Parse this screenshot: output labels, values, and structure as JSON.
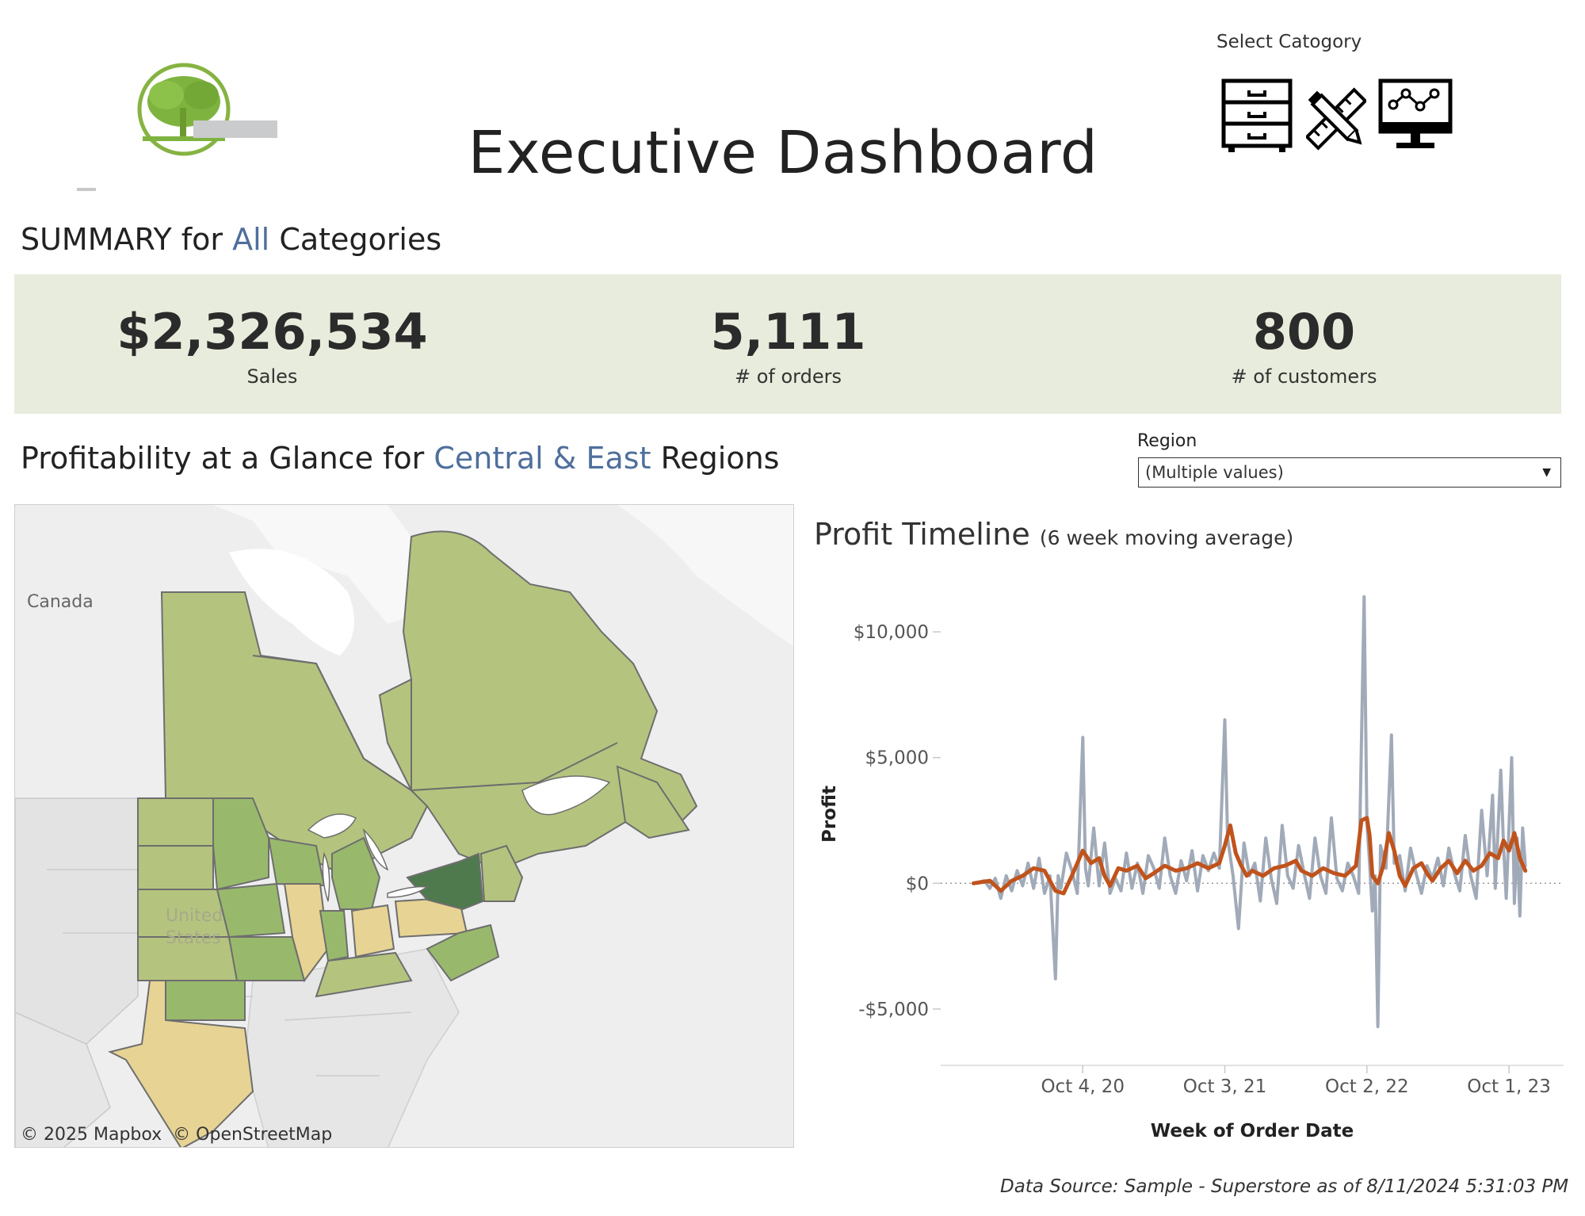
{
  "header": {
    "title": "Executive Dashboard",
    "category_selector_label": "Select Catogory",
    "category_icons": [
      "file-cabinet-icon",
      "pencil-ruler-icon",
      "computer-monitor-icon"
    ]
  },
  "summary": {
    "prefix": "SUMMARY for ",
    "highlight": "All",
    "suffix": " Categories",
    "kpis": [
      {
        "value": "$2,326,534",
        "label": "Sales"
      },
      {
        "value": "5,111",
        "label": "# of orders"
      },
      {
        "value": "800",
        "label": "# of customers"
      }
    ]
  },
  "profitability": {
    "prefix": "Profitability at a Glance for ",
    "highlight": "Central & East",
    "suffix": " Regions"
  },
  "region_filter": {
    "label": "Region",
    "value": "(Multiple values)"
  },
  "map": {
    "labels": {
      "canada": "Canada",
      "united_states": "United\nStates"
    },
    "attribution": [
      "© 2025 Mapbox",
      "© OpenStreetMap"
    ],
    "colors": {
      "light": "#b4c47e",
      "mid": "#98b96c",
      "dark": "#4e7a4e",
      "yellow": "#e7d393",
      "pale": "#d9d592",
      "gray": "#e3e3e3"
    }
  },
  "chart_data": {
    "type": "line",
    "title": "Profit Timeline",
    "subtitle": "(6 week moving average)",
    "xlabel": "Week of Order Date",
    "ylabel": "Profit",
    "yticks": [
      "$10,000",
      "$5,000",
      "$0",
      "-$5,000"
    ],
    "ytick_values": [
      10000,
      5000,
      0,
      -5000
    ],
    "ylim": [
      -6800,
      11800
    ],
    "xticks": [
      "Oct 4, 20",
      "Oct 3, 21",
      "Oct 2, 22",
      "Oct 1, 23"
    ],
    "xtick_weeks": [
      40,
      92,
      144,
      196
    ],
    "xlim": [
      -12,
      216
    ],
    "series": [
      {
        "color": "#a1aab8",
        "anchors": [
          [
            0,
            0
          ],
          [
            4,
            100
          ],
          [
            6,
            -200
          ],
          [
            8,
            200
          ],
          [
            10,
            -600
          ],
          [
            12,
            300
          ],
          [
            14,
            -300
          ],
          [
            16,
            500
          ],
          [
            18,
            -100
          ],
          [
            20,
            800
          ],
          [
            22,
            -200
          ],
          [
            24,
            1000
          ],
          [
            26,
            -400
          ],
          [
            28,
            300
          ],
          [
            30,
            -3800
          ],
          [
            31,
            300
          ],
          [
            32,
            -200
          ],
          [
            34,
            1200
          ],
          [
            36,
            500
          ],
          [
            38,
            -400
          ],
          [
            40,
            5800
          ],
          [
            41,
            600
          ],
          [
            42,
            -100
          ],
          [
            44,
            2200
          ],
          [
            46,
            -100
          ],
          [
            48,
            1600
          ],
          [
            50,
            -400
          ],
          [
            52,
            200
          ],
          [
            54,
            -300
          ],
          [
            56,
            1200
          ],
          [
            58,
            -200
          ],
          [
            60,
            800
          ],
          [
            62,
            -400
          ],
          [
            64,
            1100
          ],
          [
            66,
            600
          ],
          [
            68,
            -200
          ],
          [
            70,
            1800
          ],
          [
            72,
            300
          ],
          [
            74,
            -400
          ],
          [
            76,
            900
          ],
          [
            78,
            100
          ],
          [
            80,
            1300
          ],
          [
            82,
            -300
          ],
          [
            84,
            1100
          ],
          [
            86,
            500
          ],
          [
            88,
            1200
          ],
          [
            90,
            600
          ],
          [
            92,
            6500
          ],
          [
            93,
            1800
          ],
          [
            95,
            300
          ],
          [
            97,
            -1800
          ],
          [
            99,
            1600
          ],
          [
            101,
            300
          ],
          [
            103,
            800
          ],
          [
            105,
            -700
          ],
          [
            107,
            1800
          ],
          [
            109,
            200
          ],
          [
            111,
            -800
          ],
          [
            113,
            2300
          ],
          [
            115,
            300
          ],
          [
            117,
            -200
          ],
          [
            119,
            1500
          ],
          [
            121,
            400
          ],
          [
            123,
            -600
          ],
          [
            125,
            1800
          ],
          [
            127,
            300
          ],
          [
            129,
            -400
          ],
          [
            131,
            2600
          ],
          [
            133,
            200
          ],
          [
            135,
            -300
          ],
          [
            137,
            800
          ],
          [
            139,
            300
          ],
          [
            141,
            -400
          ],
          [
            143,
            11400
          ],
          [
            144,
            2400
          ],
          [
            145,
            800
          ],
          [
            146,
            -1100
          ],
          [
            147,
            300
          ],
          [
            148,
            -5700
          ],
          [
            149,
            1500
          ],
          [
            151,
            600
          ],
          [
            153,
            5900
          ],
          [
            154,
            800
          ],
          [
            156,
            1100
          ],
          [
            158,
            -300
          ],
          [
            160,
            1400
          ],
          [
            162,
            400
          ],
          [
            164,
            -400
          ],
          [
            166,
            700
          ],
          [
            168,
            200
          ],
          [
            170,
            1000
          ],
          [
            172,
            -100
          ],
          [
            174,
            1400
          ],
          [
            176,
            400
          ],
          [
            178,
            -300
          ],
          [
            180,
            1900
          ],
          [
            182,
            300
          ],
          [
            184,
            -600
          ],
          [
            186,
            2900
          ],
          [
            188,
            300
          ],
          [
            190,
            3500
          ],
          [
            191,
            -200
          ],
          [
            193,
            4500
          ],
          [
            194,
            1500
          ],
          [
            195,
            -600
          ],
          [
            197,
            5000
          ],
          [
            198,
            -800
          ],
          [
            199,
            1800
          ],
          [
            200,
            -1300
          ],
          [
            201,
            2200
          ],
          [
            202,
            700
          ]
        ]
      },
      {
        "color": "#c0531c",
        "anchors": [
          [
            0,
            0
          ],
          [
            6,
            100
          ],
          [
            10,
            -300
          ],
          [
            14,
            100
          ],
          [
            18,
            300
          ],
          [
            22,
            600
          ],
          [
            26,
            500
          ],
          [
            30,
            -300
          ],
          [
            33,
            -400
          ],
          [
            36,
            300
          ],
          [
            40,
            1300
          ],
          [
            43,
            800
          ],
          [
            46,
            1000
          ],
          [
            48,
            300
          ],
          [
            50,
            -100
          ],
          [
            53,
            600
          ],
          [
            56,
            500
          ],
          [
            60,
            700
          ],
          [
            63,
            200
          ],
          [
            66,
            400
          ],
          [
            70,
            700
          ],
          [
            74,
            500
          ],
          [
            78,
            600
          ],
          [
            82,
            800
          ],
          [
            86,
            600
          ],
          [
            90,
            800
          ],
          [
            92,
            1500
          ],
          [
            94,
            2300
          ],
          [
            96,
            1200
          ],
          [
            98,
            700
          ],
          [
            100,
            300
          ],
          [
            102,
            500
          ],
          [
            106,
            300
          ],
          [
            110,
            600
          ],
          [
            114,
            700
          ],
          [
            118,
            900
          ],
          [
            120,
            500
          ],
          [
            124,
            300
          ],
          [
            128,
            600
          ],
          [
            132,
            400
          ],
          [
            136,
            300
          ],
          [
            140,
            700
          ],
          [
            142,
            2500
          ],
          [
            144,
            2600
          ],
          [
            145,
            1900
          ],
          [
            146,
            300
          ],
          [
            148,
            0
          ],
          [
            150,
            700
          ],
          [
            152,
            2000
          ],
          [
            154,
            1300
          ],
          [
            156,
            300
          ],
          [
            158,
            -100
          ],
          [
            161,
            600
          ],
          [
            164,
            800
          ],
          [
            166,
            400
          ],
          [
            168,
            100
          ],
          [
            171,
            600
          ],
          [
            174,
            900
          ],
          [
            177,
            400
          ],
          [
            180,
            900
          ],
          [
            183,
            500
          ],
          [
            186,
            700
          ],
          [
            189,
            1200
          ],
          [
            192,
            1000
          ],
          [
            194,
            1700
          ],
          [
            196,
            1300
          ],
          [
            198,
            2000
          ],
          [
            200,
            1000
          ],
          [
            202,
            500
          ]
        ]
      }
    ]
  },
  "footer": {
    "text": "Data  Source: Sample - Superstore  as of 8/11/2024 5:31:03 PM"
  }
}
